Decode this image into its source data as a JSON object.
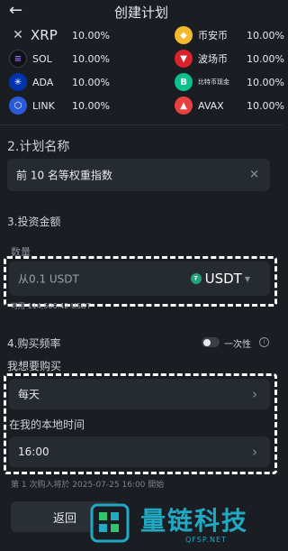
{
  "header": {
    "title": "创建计划",
    "back_icon": "arrow-left-icon"
  },
  "coins": {
    "left": [
      {
        "name": "XRP",
        "pct": "10.00%",
        "icon": "x-icon",
        "color": "#3a3f47",
        "glyph": "✕"
      },
      {
        "name": "SOL",
        "pct": "10.00%",
        "icon": "solana-icon",
        "color": "#101418",
        "glyph": "≡"
      },
      {
        "name": "ADA",
        "pct": "10.00%",
        "icon": "cardano-icon",
        "color": "#0033ad",
        "glyph": "✳"
      },
      {
        "name": "LINK",
        "pct": "10.00%",
        "icon": "chainlink-icon",
        "color": "#2a5ada",
        "glyph": "⬡"
      }
    ],
    "right": [
      {
        "name": "币安币",
        "pct": "10.00%",
        "icon": "bnb-icon",
        "color": "#f3ba2f",
        "glyph": "◆"
      },
      {
        "name": "波场币",
        "pct": "10.00%",
        "icon": "tron-icon",
        "color": "#d9222a",
        "glyph": "▼"
      },
      {
        "name": "比特币现金",
        "pct": "10.00%",
        "icon": "bitcoin-cash-icon",
        "color": "#0ac18e",
        "glyph": "B"
      },
      {
        "name": "AVAX",
        "pct": "10.00%",
        "icon": "avalanche-icon",
        "color": "#e84142",
        "glyph": "▲"
      }
    ]
  },
  "plan_name": {
    "section": "2.计划名称",
    "value": "前 10 名等权重指数"
  },
  "investment": {
    "section": "3.投资金额",
    "qty_label": "数量",
    "amount_placeholder": "从0.1 USDT",
    "currency": "USDT",
    "available": "可用 114,506.42 USDT"
  },
  "frequency": {
    "section": "4.购买频率",
    "one_time_label": "一次性",
    "want_label": "我想要购买",
    "period": "每天",
    "local_time_label": "在我的本地时间",
    "time": "16:00",
    "first_buy_note": "第 1 次购入将於 2025-07-25 16:00 開始"
  },
  "footer": {
    "back_label": "返回"
  },
  "watermark": {
    "text": "量链科技",
    "sub": "QFSP.NET"
  }
}
